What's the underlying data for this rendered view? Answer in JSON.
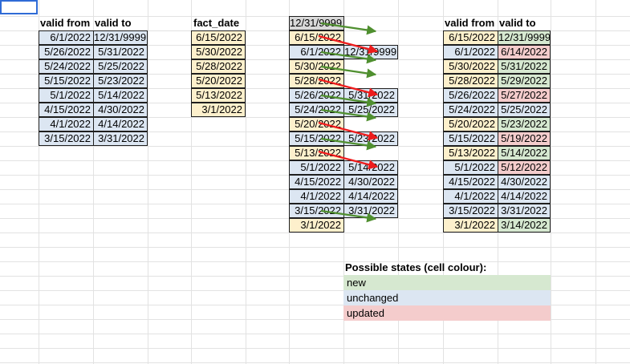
{
  "colors": {
    "blue": "#dce6f2",
    "yellow": "#fdf0cc",
    "green": "#d6e8d0",
    "red": "#f4cccc",
    "gray": "#d9d9d9",
    "arrow_green": "#4f8f2f",
    "arrow_red": "#ee1c1c"
  },
  "table1": {
    "header_from": "valid from",
    "header_to": "valid to",
    "rows": [
      [
        "6/1/2022",
        "12/31/9999"
      ],
      [
        "5/26/2022",
        "5/31/2022"
      ],
      [
        "5/24/2022",
        "5/25/2022"
      ],
      [
        "5/15/2022",
        "5/23/2022"
      ],
      [
        "5/1/2022",
        "5/14/2022"
      ],
      [
        "4/15/2022",
        "4/30/2022"
      ],
      [
        "4/1/2022",
        "4/14/2022"
      ],
      [
        "3/15/2022",
        "3/31/2022"
      ]
    ]
  },
  "facts": {
    "header": "fact_date",
    "rows": [
      "6/15/2022",
      "5/30/2022",
      "5/28/2022",
      "5/20/2022",
      "5/13/2022",
      "3/1/2022"
    ]
  },
  "middle": {
    "rows": [
      {
        "a": "12/31/9999",
        "b": "",
        "fill": "gray"
      },
      {
        "a": "6/15/2022",
        "b": "",
        "fill": "yellow"
      },
      {
        "a": "6/1/2022",
        "b": "12/31/9999",
        "fill": "blue"
      },
      {
        "a": "5/30/2022",
        "b": "",
        "fill": "yellow"
      },
      {
        "a": "5/28/2022",
        "b": "",
        "fill": "yellow"
      },
      {
        "a": "5/26/2022",
        "b": "5/31/2022",
        "fill": "blue"
      },
      {
        "a": "5/24/2022",
        "b": "5/25/2022",
        "fill": "blue"
      },
      {
        "a": "5/20/2022",
        "b": "",
        "fill": "yellow"
      },
      {
        "a": "5/15/2022",
        "b": "5/23/2022",
        "fill": "blue"
      },
      {
        "a": "5/13/2022",
        "b": "",
        "fill": "yellow"
      },
      {
        "a": "5/1/2022",
        "b": "5/14/2022",
        "fill": "blue"
      },
      {
        "a": "4/15/2022",
        "b": "4/30/2022",
        "fill": "blue"
      },
      {
        "a": "4/1/2022",
        "b": "4/14/2022",
        "fill": "blue"
      },
      {
        "a": "3/15/2022",
        "b": "3/31/2022",
        "fill": "blue"
      },
      {
        "a": "3/1/2022",
        "b": "",
        "fill": "yellow"
      }
    ],
    "arrows": [
      {
        "row": 0,
        "color": "arrow_green"
      },
      {
        "row": 1,
        "color": "arrow_red"
      },
      {
        "row": 2,
        "color": "arrow_green"
      },
      {
        "row": 3,
        "color": "arrow_green"
      },
      {
        "row": 4,
        "color": "arrow_red"
      },
      {
        "row": 5,
        "color": "arrow_green"
      },
      {
        "row": 6,
        "color": "arrow_green"
      },
      {
        "row": 7,
        "color": "arrow_red"
      },
      {
        "row": 8,
        "color": "arrow_green"
      },
      {
        "row": 9,
        "color": "arrow_red"
      },
      {
        "row": 13,
        "color": "arrow_green"
      }
    ]
  },
  "table2": {
    "header_from": "valid from",
    "header_to": "valid to",
    "rows": [
      {
        "from": "6/15/2022",
        "to": "12/31/9999",
        "from_fill": "yellow",
        "to_fill": "green"
      },
      {
        "from": "6/1/2022",
        "to": "6/14/2022",
        "from_fill": "blue",
        "to_fill": "red"
      },
      {
        "from": "5/30/2022",
        "to": "5/31/2022",
        "from_fill": "yellow",
        "to_fill": "green"
      },
      {
        "from": "5/28/2022",
        "to": "5/29/2022",
        "from_fill": "yellow",
        "to_fill": "green"
      },
      {
        "from": "5/26/2022",
        "to": "5/27/2022",
        "from_fill": "blue",
        "to_fill": "red"
      },
      {
        "from": "5/24/2022",
        "to": "5/25/2022",
        "from_fill": "blue",
        "to_fill": "blue"
      },
      {
        "from": "5/20/2022",
        "to": "5/23/2022",
        "from_fill": "yellow",
        "to_fill": "green"
      },
      {
        "from": "5/15/2022",
        "to": "5/19/2022",
        "from_fill": "blue",
        "to_fill": "red"
      },
      {
        "from": "5/13/2022",
        "to": "5/14/2022",
        "from_fill": "yellow",
        "to_fill": "green"
      },
      {
        "from": "5/1/2022",
        "to": "5/12/2022",
        "from_fill": "blue",
        "to_fill": "red"
      },
      {
        "from": "4/15/2022",
        "to": "4/30/2022",
        "from_fill": "blue",
        "to_fill": "blue"
      },
      {
        "from": "4/1/2022",
        "to": "4/14/2022",
        "from_fill": "blue",
        "to_fill": "blue"
      },
      {
        "from": "3/15/2022",
        "to": "3/31/2022",
        "from_fill": "blue",
        "to_fill": "blue"
      },
      {
        "from": "3/1/2022",
        "to": "3/14/2022",
        "from_fill": "yellow",
        "to_fill": "green"
      }
    ]
  },
  "legend": {
    "title": "Possible states (cell colour):",
    "items": [
      {
        "label": "new",
        "fill": "green"
      },
      {
        "label": "unchanged",
        "fill": "blue"
      },
      {
        "label": "updated",
        "fill": "red"
      }
    ]
  }
}
